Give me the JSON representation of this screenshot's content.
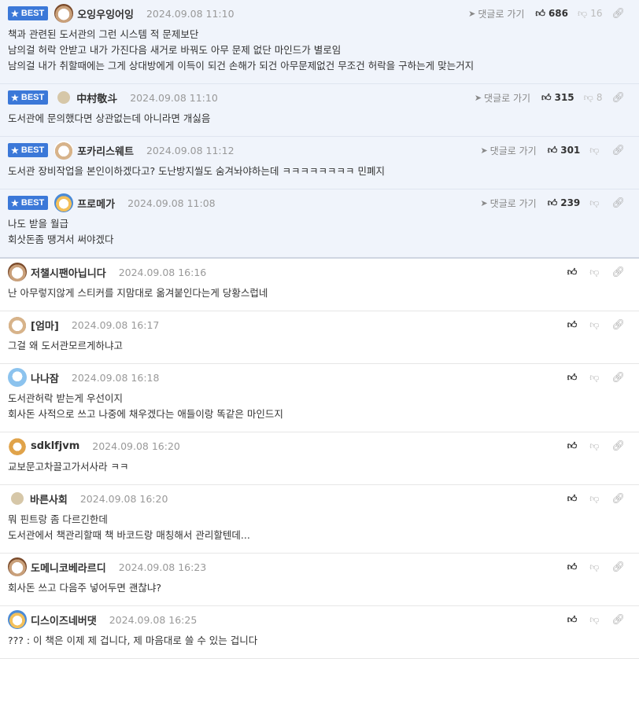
{
  "labels": {
    "best": "BEST",
    "reply": "댓글로 가기"
  },
  "comments": [
    {
      "best": true,
      "avatar": "dog-avatar",
      "name": "오잉우잉어잉",
      "date": "2024.09.08 11:10",
      "up": "686",
      "down": "16",
      "lines": [
        "책과 관련된 도서관의 그런 시스템 적 문제보단",
        "남의걸 허락 안받고 내가 가진다음 새거로 바꿔도 아무 문제 없단 마인드가 별로임",
        "남의걸 내가 취할때에는 그게 상대방에게 이득이 되건 손해가 되건 아무문제없건 무조건 허락을 구하는게 맞는거지"
      ]
    },
    {
      "best": true,
      "avatar": "dot-avatar",
      "name": "中村敬斗",
      "date": "2024.09.08 11:10",
      "up": "315",
      "down": "8",
      "lines": [
        "도서관에 문의했다면 상관없는데 아니라면 개싫음"
      ]
    },
    {
      "best": true,
      "avatar": "dog2-avatar",
      "name": "포카리스웨트",
      "date": "2024.09.08 11:12",
      "up": "301",
      "down": "",
      "lines": [
        "도서관 장비작업을 본인이하겠다고? 도난방지씰도 숨겨놔야하는데 ㅋㅋㅋㅋㅋㅋㅋㅋ 민폐지"
      ]
    },
    {
      "best": true,
      "avatar": "multi-avatar",
      "name": "프로메가",
      "date": "2024.09.08 11:08",
      "up": "239",
      "down": "",
      "lines": [
        "나도 받을 월급",
        "회삿돈좀 땡겨서 써야겠다"
      ]
    },
    {
      "best": false,
      "avatar": "dog-avatar",
      "name": "저챌시팬아닙니다",
      "date": "2024.09.08 16:16",
      "up": "",
      "down": "",
      "lines": [
        "난 아무렇지않게 스티커를 지맘대로 옮겨붙인다는게 당황스럽네"
      ]
    },
    {
      "best": false,
      "avatar": "dog2-avatar",
      "name": "[엄마]",
      "date": "2024.09.08 16:17",
      "up": "",
      "down": "",
      "lines": [
        "그걸 왜 도서관모르게하냐고"
      ]
    },
    {
      "best": false,
      "avatar": "blue-avatar",
      "name": "나나잠",
      "date": "2024.09.08 16:18",
      "up": "",
      "down": "",
      "lines": [
        "도서관허락 받는게 우선이지",
        "회사돈 사적으로 쓰고 나중에 채우겠다는 애들이랑 똑같은 마인드지"
      ]
    },
    {
      "best": false,
      "avatar": "fox-avatar",
      "name": "sdklfjvm",
      "date": "2024.09.08 16:20",
      "up": "",
      "down": "",
      "lines": [
        "교보문고차끌고가서사라 ㅋㅋ"
      ]
    },
    {
      "best": false,
      "avatar": "dot-avatar",
      "name": "바른사회",
      "date": "2024.09.08 16:20",
      "up": "",
      "down": "",
      "lines": [
        "뭐 핀트랑 좀 다르긴한데",
        "도서관에서 책관리할때 책 바코드랑 매칭해서 관리할텐데..."
      ]
    },
    {
      "best": false,
      "avatar": "dog-avatar",
      "name": "도메니코베라르디",
      "date": "2024.09.08 16:23",
      "up": "",
      "down": "",
      "lines": [
        "회사돈 쓰고 다음주 넣어두면 괜찮냐?"
      ]
    },
    {
      "best": false,
      "avatar": "multi-avatar",
      "name": "디스이즈네버댓",
      "date": "2024.09.08 16:25",
      "up": "",
      "down": "",
      "lines": [
        "??? : 이 책은 이제 제 겁니다, 제 마음대로 쓸 수 있는 겁니다"
      ]
    }
  ]
}
